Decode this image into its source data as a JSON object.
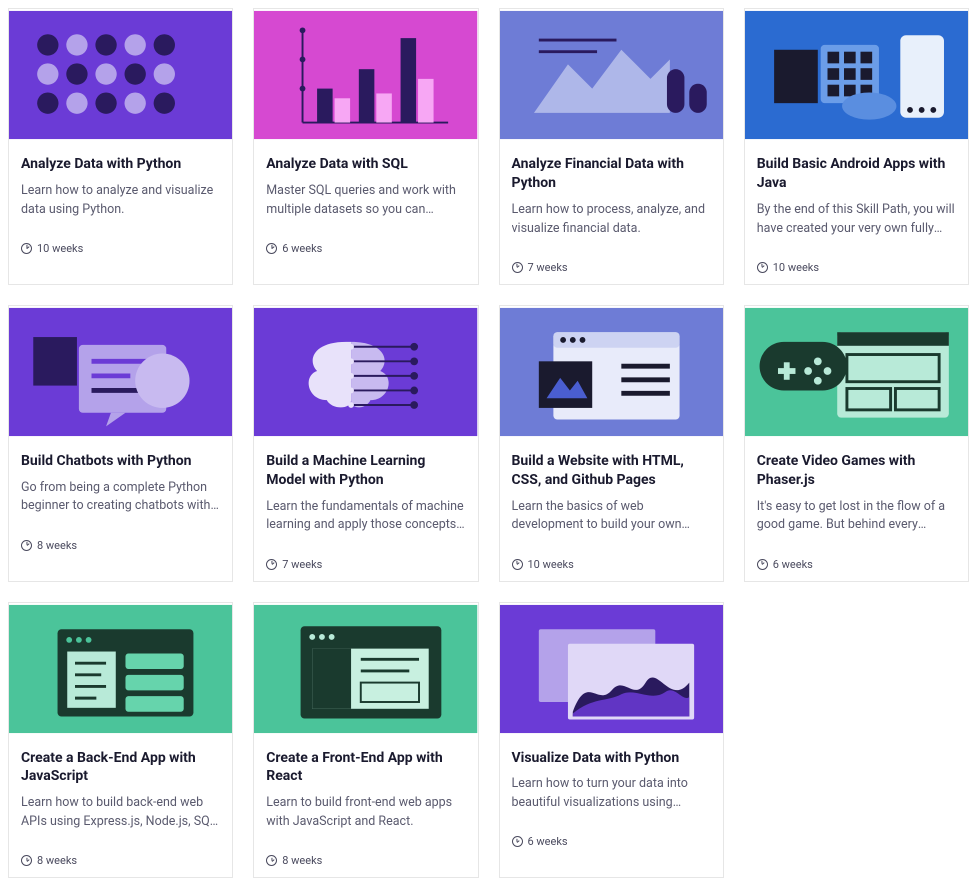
{
  "cards": [
    {
      "title": "Analyze Data with Python",
      "desc": "Learn how to analyze and visualize data using Python.",
      "duration": "10 weeks",
      "art": "dots"
    },
    {
      "title": "Analyze Data with SQL",
      "desc": "Master SQL queries and work with multiple datasets so you can analyze your business data.",
      "duration": "6 weeks",
      "art": "bars"
    },
    {
      "title": "Analyze Financial Data with Python",
      "desc": "Learn how to process, analyze, and visualize financial data.",
      "duration": "7 weeks",
      "art": "area"
    },
    {
      "title": "Build Basic Android Apps with Java",
      "desc": "By the end of this Skill Path, you will have created your very own fully functional Android app.",
      "duration": "10 weeks",
      "art": "android"
    },
    {
      "title": "Build Chatbots with Python",
      "desc": "Go from being a complete Python beginner to creating chatbots with deep learning.",
      "duration": "8 weeks",
      "art": "chat"
    },
    {
      "title": "Build a Machine Learning Model with Python",
      "desc": "Learn the fundamentals of machine learning and apply those concepts to real-world data.",
      "duration": "7 weeks",
      "art": "brain"
    },
    {
      "title": "Build a Website with HTML, CSS, and Github Pages",
      "desc": "Learn the basics of web development to build your own website.",
      "duration": "10 weeks",
      "art": "webpage"
    },
    {
      "title": "Create Video Games with Phaser.js",
      "desc": "It's easy to get lost in the flow of a good game. But behind every power-up and boss battle is simple code.",
      "duration": "6 weeks",
      "art": "game"
    },
    {
      "title": "Create a Back-End App with JavaScript",
      "desc": "Learn how to build back-end web APIs using Express.js, Node.js, SQL, and a Node.js-SQLite database.",
      "duration": "8 weeks",
      "art": "backend"
    },
    {
      "title": "Create a Front-End App with React",
      "desc": "Learn to build front-end web apps with JavaScript and React.",
      "duration": "8 weeks",
      "art": "frontend"
    },
    {
      "title": "Visualize Data with Python",
      "desc": "Learn how to turn your data into beautiful visualizations using Python!",
      "duration": "6 weeks",
      "art": "viz"
    }
  ]
}
